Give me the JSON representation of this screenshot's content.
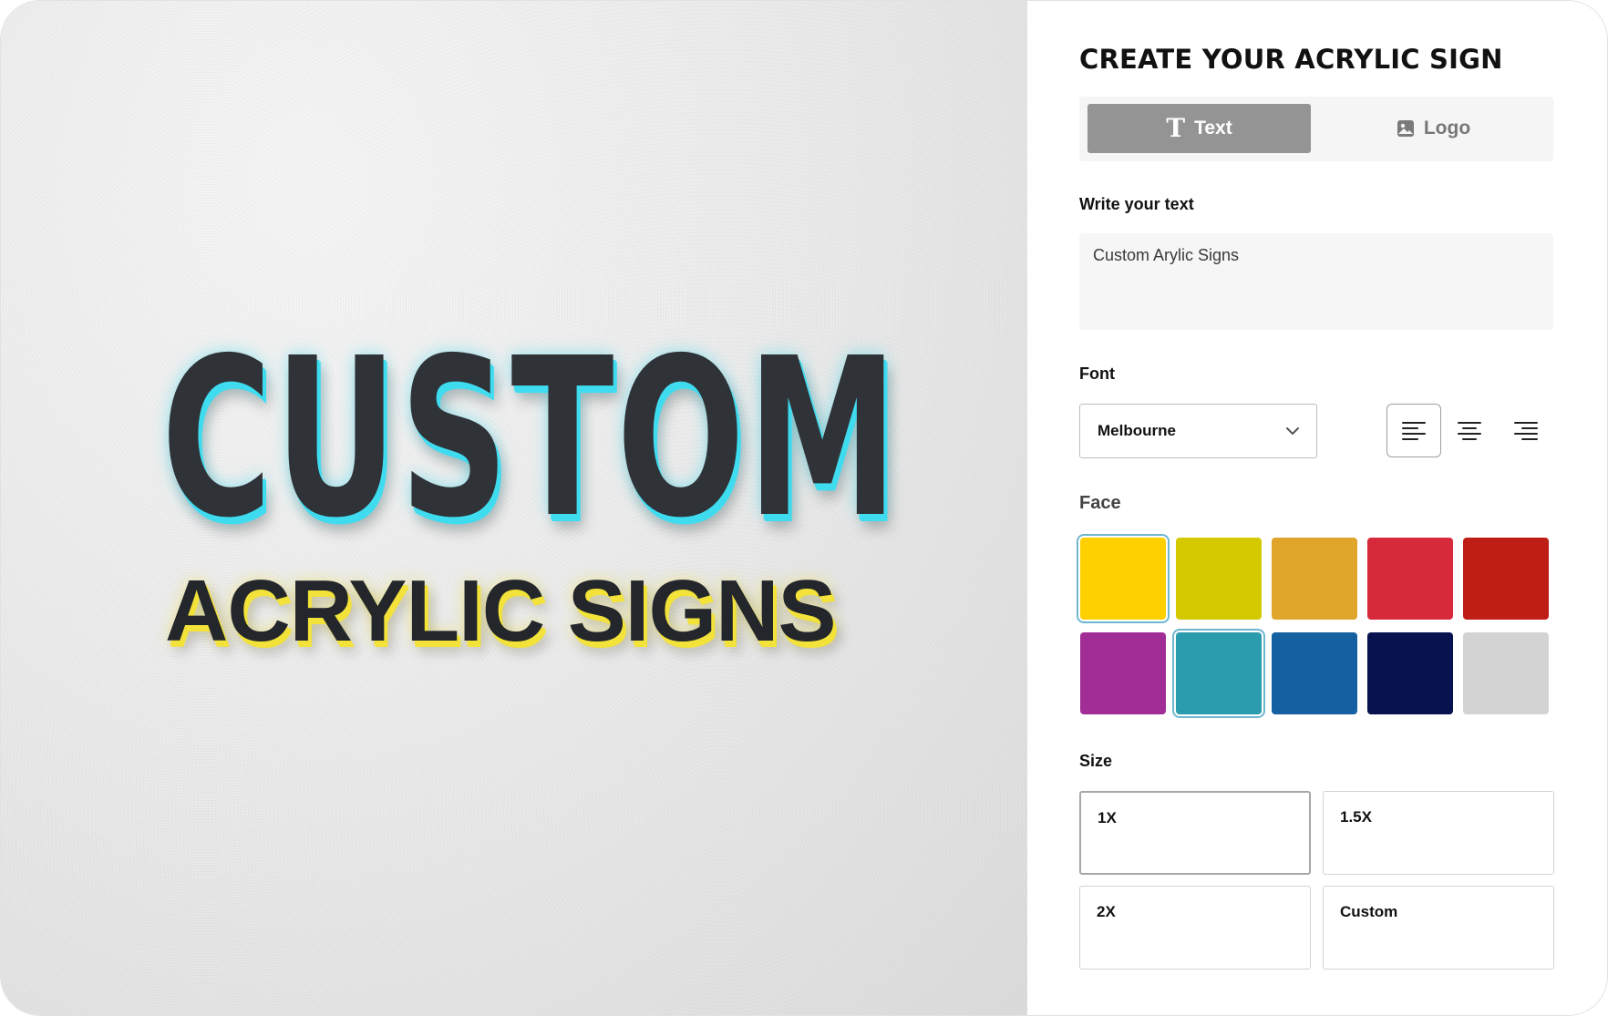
{
  "preview": {
    "headline": "CUSTOM",
    "subline": "ACRYLIC SIGNS",
    "headline_glow": "#3fdcf0",
    "subline_glow": "#f2e23a"
  },
  "panel": {
    "title": "CREATE YOUR ACRYLIC SIGN",
    "tabs": [
      {
        "label": "Text",
        "icon": "text-t-icon",
        "active": true
      },
      {
        "label": "Logo",
        "icon": "image-icon",
        "active": false
      }
    ],
    "text_section": {
      "label": "Write your text",
      "value": "Custom Arylic Signs"
    },
    "font_section": {
      "label": "Font",
      "selected_font": "Melbourne",
      "alignments": [
        {
          "name": "align-left-icon",
          "active": true
        },
        {
          "name": "align-center-icon",
          "active": false
        },
        {
          "name": "align-right-icon",
          "active": false
        }
      ]
    },
    "face_section": {
      "label": "Face",
      "colors": [
        {
          "hex": "#FFD000",
          "selected": true
        },
        {
          "hex": "#D4C900",
          "selected": false
        },
        {
          "hex": "#E0A52B",
          "selected": false
        },
        {
          "hex": "#D62A3C",
          "selected": false
        },
        {
          "hex": "#BE1E16",
          "selected": false
        },
        {
          "hex": "#A12D96",
          "selected": false
        },
        {
          "hex": "#2B9BAE",
          "selected": true
        },
        {
          "hex": "#1560A0",
          "selected": false
        },
        {
          "hex": "#07124F",
          "selected": false
        },
        {
          "hex": "#D3D3D3",
          "selected": false
        }
      ]
    },
    "size_section": {
      "label": "Size",
      "options": [
        {
          "label": "1X",
          "selected": true
        },
        {
          "label": "1.5X",
          "selected": false
        },
        {
          "label": "2X",
          "selected": false
        },
        {
          "label": "Custom",
          "selected": false
        }
      ]
    }
  }
}
